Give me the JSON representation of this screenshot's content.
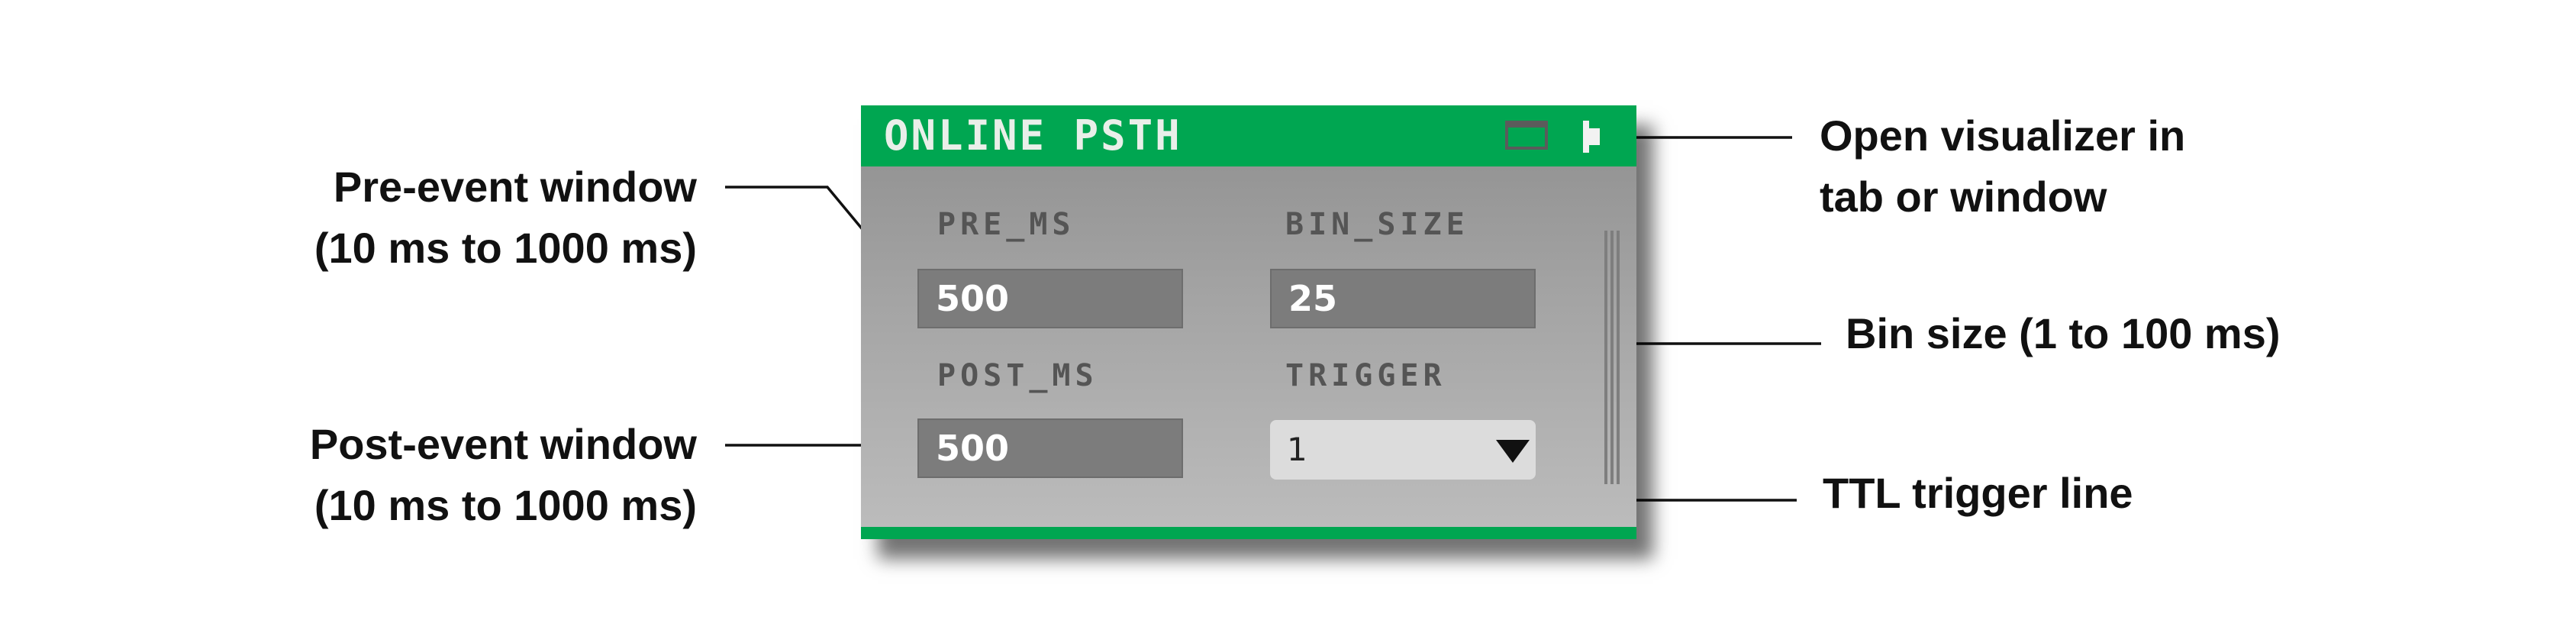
{
  "plugin": {
    "title": "ONLINE PSTH",
    "tab_icon": "tab-icon",
    "window_icon": "window-icon",
    "accent_color": "#00a651",
    "params": {
      "pre_ms": {
        "label": "PRE_MS",
        "value": "500"
      },
      "bin_size": {
        "label": "BIN_SIZE",
        "value": "25"
      },
      "post_ms": {
        "label": "POST_MS",
        "value": "500"
      },
      "trigger": {
        "label": "TRIGGER",
        "value": "1"
      }
    }
  },
  "annotations": {
    "pre_event": [
      "Pre-event window",
      "(10 ms to 1000 ms)"
    ],
    "post_event": [
      "Post-event window",
      "(10 ms to 1000 ms)"
    ],
    "open_visualizer": [
      "Open visualizer in",
      "tab or window"
    ],
    "bin_size": [
      "Bin size (1 to 100 ms)"
    ],
    "ttl_trigger": [
      "TTL trigger line"
    ]
  }
}
